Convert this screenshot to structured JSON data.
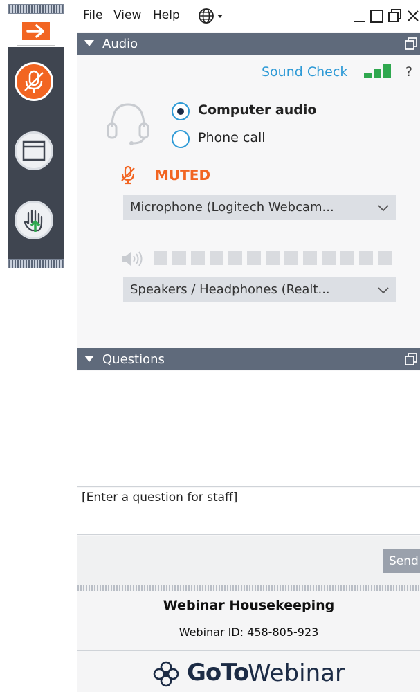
{
  "menu": {
    "file": "File",
    "view": "View",
    "help": "Help"
  },
  "icons": {
    "expand": "right-arrow-icon",
    "microphone_muted": "microphone-muted-icon",
    "window": "window-icon",
    "raise_hand": "raise-hand-icon",
    "language": "globe-icon",
    "headset": "headset-icon",
    "speaker": "speaker-icon",
    "popout": "popout-icon"
  },
  "colors": {
    "accent_orange": "#f26522",
    "link_blue": "#2e9ad6",
    "signal_green": "#2fa84f",
    "header_gray": "#5f6a7b"
  },
  "audio": {
    "header": "Audio",
    "sound_check": "Sound Check",
    "help": "?",
    "signal_level": "3 of 3 bars",
    "options": [
      "Computer audio",
      "Phone call"
    ],
    "selected_option": "Computer audio",
    "mute_status": "MUTED",
    "microphone_select": "Microphone (Logitech Webcam...",
    "speaker_select": "Speakers / Headphones (Realt...",
    "speaker_level_segments": 13,
    "speaker_level_filled": 0
  },
  "questions": {
    "header": "Questions",
    "input_text": "[Enter a question for staff]",
    "send_button": "Send"
  },
  "footer": {
    "title": "Webinar Housekeeping",
    "webinar_id": "Webinar ID: 458-805-923",
    "brand_goto": "GoTo",
    "brand_webinar": "Webinar"
  }
}
